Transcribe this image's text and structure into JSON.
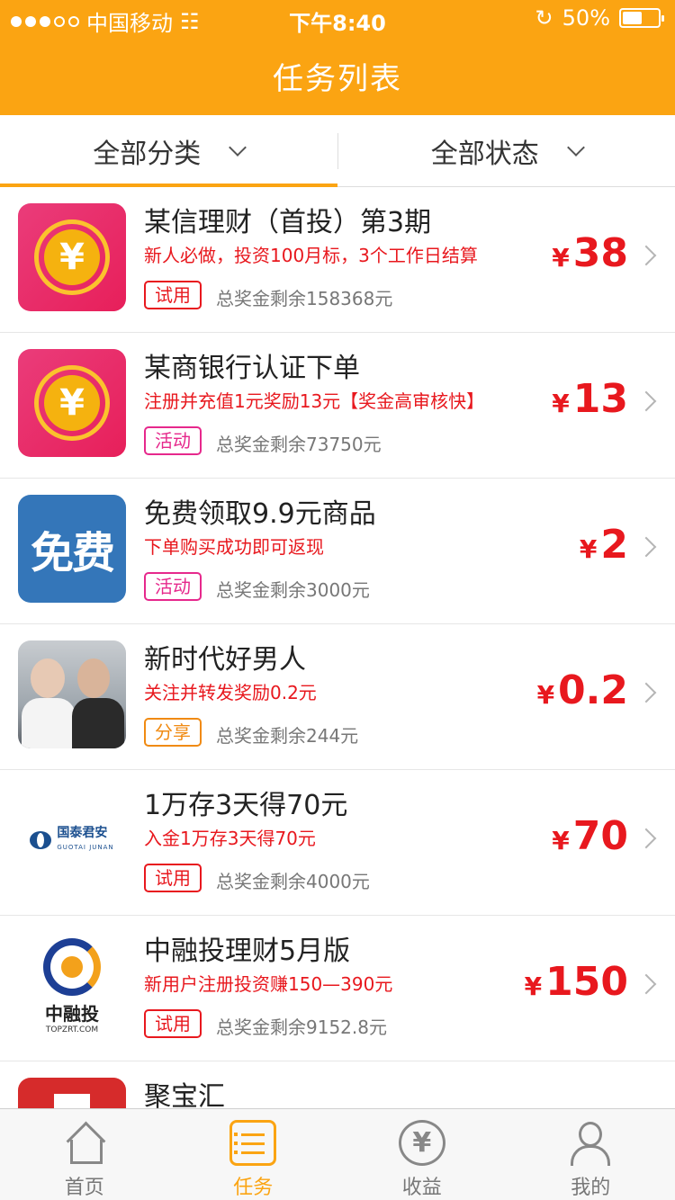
{
  "status_bar": {
    "carrier": "中国移动",
    "time": "下午8:40",
    "battery": "50%"
  },
  "header": {
    "title": "任务列表"
  },
  "filters": [
    {
      "label": "全部分类"
    },
    {
      "label": "全部状态"
    }
  ],
  "tasks": [
    {
      "name": "某信理财（首投）第3期",
      "desc": "新人必做，投资100月标，3个工作日结算",
      "tag": "试用",
      "remain": "总奖金剩余158368元",
      "currency": "¥",
      "reward": "38",
      "icon": "coin-icon"
    },
    {
      "name": "某商银行认证下单",
      "desc": "注册并充值1元奖励13元【奖金高审核快】",
      "tag": "活动",
      "remain": "总奖金剩余73750元",
      "currency": "¥",
      "reward": "13",
      "icon": "coin-icon"
    },
    {
      "name": "免费领取9.9元商品",
      "desc": "下单购买成功即可返现",
      "tag": "活动",
      "remain": "总奖金剩余3000元",
      "currency": "¥",
      "reward": "2",
      "icon": "free-icon",
      "icon_text": "免费"
    },
    {
      "name": "新时代好男人",
      "desc": "关注并转发奖励0.2元",
      "tag": "分享",
      "remain": "总奖金剩余244元",
      "currency": "¥",
      "reward": "0.2",
      "icon": "couple-photo-icon"
    },
    {
      "name": "1万存3天得70元",
      "desc": "入金1万存3天得70元",
      "tag": "试用",
      "remain": "总奖金剩余4000元",
      "currency": "¥",
      "reward": "70",
      "icon": "guotai-junan-logo",
      "icon_text": "国泰君安",
      "icon_sub": "GUOTAI JUNAN"
    },
    {
      "name": "中融投理财5月版",
      "desc": "新用户注册投资赚150—390元",
      "tag": "试用",
      "remain": "总奖金剩余9152.8元",
      "currency": "¥",
      "reward": "150",
      "icon": "zrt-logo",
      "icon_text": "中融投",
      "icon_sub": "TOPZRT.COM"
    },
    {
      "name": "聚宝汇",
      "icon": "jubaohui-logo"
    }
  ],
  "tabbar": [
    {
      "label": "首页",
      "icon": "home-icon"
    },
    {
      "label": "任务",
      "icon": "task-list-icon"
    },
    {
      "label": "收益",
      "icon": "yen-circle-icon",
      "glyph": "¥"
    },
    {
      "label": "我的",
      "icon": "user-icon"
    }
  ],
  "colors": {
    "brand": "#fba412",
    "price": "#e8181e",
    "activity": "#e6288c",
    "share": "#f08a12"
  }
}
